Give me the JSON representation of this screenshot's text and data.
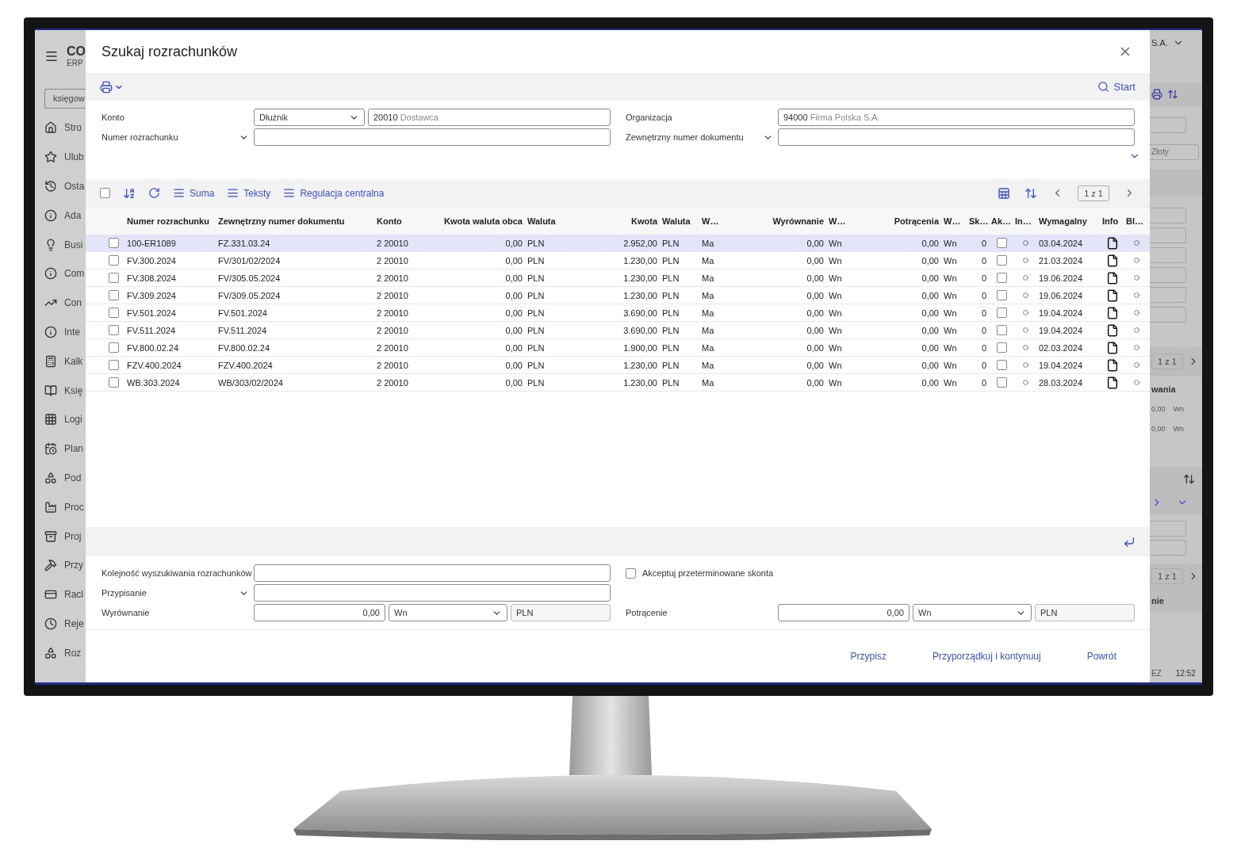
{
  "background_app": {
    "logo": "CO",
    "logo_subtitle": "ERP",
    "search_value": "księgow",
    "sidebar_items": [
      "Stro",
      "Ulub",
      "Osta",
      "Ada",
      "Busi",
      "Com",
      "Con",
      "Inte",
      "Kalk",
      "Księ",
      "Logi",
      "Plan",
      "Pod",
      "Proc",
      "Proj",
      "Przy",
      "Racl",
      "Reje",
      "Roz"
    ],
    "right_panel": {
      "company": "S.A.",
      "currency_value": "Złoty",
      "pager_1": "1 z 1",
      "column_heading": "wania",
      "amount_rows": [
        {
          "amount": "0,00",
          "side": "Wn"
        },
        {
          "amount": "0,00",
          "side": "Wn"
        }
      ],
      "pager_2": "1 z 1",
      "column_heading_2": "nie",
      "status_text": "EZ",
      "clock": "12:52"
    }
  },
  "dialog": {
    "title": "Szukaj rozrachunków",
    "start_label": "Start",
    "filters": {
      "konto_label": "Konto",
      "konto_type": "Dłużnik",
      "konto_value": "20010",
      "konto_description": "Dostawca",
      "numer_label": "Numer rozrachunku",
      "organizacja_label": "Organizacja",
      "organizacja_value": "94000",
      "organizacja_description": "Firma Polska S.A.",
      "zewnetrzny_label": "Zewnętrzny numer dokumentu"
    },
    "grid_toolbar": {
      "select_all_checked": false,
      "buttons": [
        "Suma",
        "Teksty",
        "Regulacja centralna"
      ],
      "pager": "1 z 1"
    },
    "table": {
      "columns": [
        "Numer rozrachunku",
        "Zewnętrzny numer dokumentu",
        "Konto",
        "Kwota waluta obca",
        "Waluta",
        "Kwota",
        "Waluta",
        "W…",
        "Wyrównanie",
        "W…",
        "Potrącenia",
        "W…",
        "Sk…",
        "Ak…",
        "In…",
        "Wymagalny",
        "Info",
        "Bl…"
      ],
      "rows": [
        {
          "selected": true,
          "checked": false,
          "cells": [
            "100-ER1089",
            "FZ.331.03.24",
            "2 20010",
            "0,00",
            "PLN",
            "2.952,00",
            "PLN",
            "Ma",
            "0,00",
            "Wn",
            "0,00",
            "Wn",
            "0"
          ],
          "accepted": false,
          "due": "03.04.2024"
        },
        {
          "selected": false,
          "checked": false,
          "cells": [
            "FV.300.2024",
            "FV/301/02/2024",
            "2 20010",
            "0,00",
            "PLN",
            "1.230,00",
            "PLN",
            "Ma",
            "0,00",
            "Wn",
            "0,00",
            "Wn",
            "0"
          ],
          "accepted": false,
          "due": "21.03.2024"
        },
        {
          "selected": false,
          "checked": false,
          "cells": [
            "FV.308.2024",
            "FV/305.05.2024",
            "2 20010",
            "0,00",
            "PLN",
            "1.230,00",
            "PLN",
            "Ma",
            "0,00",
            "Wn",
            "0,00",
            "Wn",
            "0"
          ],
          "accepted": false,
          "due": "19.06.2024"
        },
        {
          "selected": false,
          "checked": false,
          "cells": [
            "FV.309.2024",
            "FV/309.05.2024",
            "2 20010",
            "0,00",
            "PLN",
            "1.230,00",
            "PLN",
            "Ma",
            "0,00",
            "Wn",
            "0,00",
            "Wn",
            "0"
          ],
          "accepted": false,
          "due": "19.06.2024"
        },
        {
          "selected": false,
          "checked": false,
          "cells": [
            "FV.501.2024",
            "FV.501.2024",
            "2 20010",
            "0,00",
            "PLN",
            "3.690,00",
            "PLN",
            "Ma",
            "0,00",
            "Wn",
            "0,00",
            "Wn",
            "0"
          ],
          "accepted": false,
          "due": "19.04.2024"
        },
        {
          "selected": false,
          "checked": false,
          "cells": [
            "FV.511.2024",
            "FV.511.2024",
            "2 20010",
            "0,00",
            "PLN",
            "3.690,00",
            "PLN",
            "Ma",
            "0,00",
            "Wn",
            "0,00",
            "Wn",
            "0"
          ],
          "accepted": false,
          "due": "19.04.2024"
        },
        {
          "selected": false,
          "checked": false,
          "cells": [
            "FV.800.02.24",
            "FV.800.02.24",
            "2 20010",
            "0,00",
            "PLN",
            "1.900,00",
            "PLN",
            "Ma",
            "0,00",
            "Wn",
            "0,00",
            "Wn",
            "0"
          ],
          "accepted": false,
          "due": "02.03.2024"
        },
        {
          "selected": false,
          "checked": false,
          "cells": [
            "FZV.400.2024",
            "FZV.400.2024",
            "2 20010",
            "0,00",
            "PLN",
            "1.230,00",
            "PLN",
            "Ma",
            "0,00",
            "Wn",
            "0,00",
            "Wn",
            "0"
          ],
          "accepted": false,
          "due": "19.04.2024"
        },
        {
          "selected": false,
          "checked": false,
          "cells": [
            "WB.303.2024",
            "WB/303/02/2024",
            "2 20010",
            "0,00",
            "PLN",
            "1.230,00",
            "PLN",
            "Ma",
            "0,00",
            "Wn",
            "0,00",
            "Wn",
            "0"
          ],
          "accepted": false,
          "due": "28.03.2024"
        }
      ]
    },
    "assignment": {
      "order_label": "Kolejność wyszukiwania rozrachunków",
      "accept_label": "Akceptuj przeterminowane skonta",
      "accept_checked": false,
      "przypisanie_label": "Przypisanie",
      "wyrownanie_label": "Wyrównanie",
      "wyrownanie_amount": "0,00",
      "wyrownanie_side": "Wn",
      "wyrownanie_currency": "PLN",
      "potracenie_label": "Potrącenie",
      "potracenie_amount": "0,00",
      "potracenie_side": "Wn",
      "potracenie_currency": "PLN"
    },
    "actions": [
      "Przypisz",
      "Przyporządkuj i kontynuuj",
      "Powrót"
    ]
  }
}
